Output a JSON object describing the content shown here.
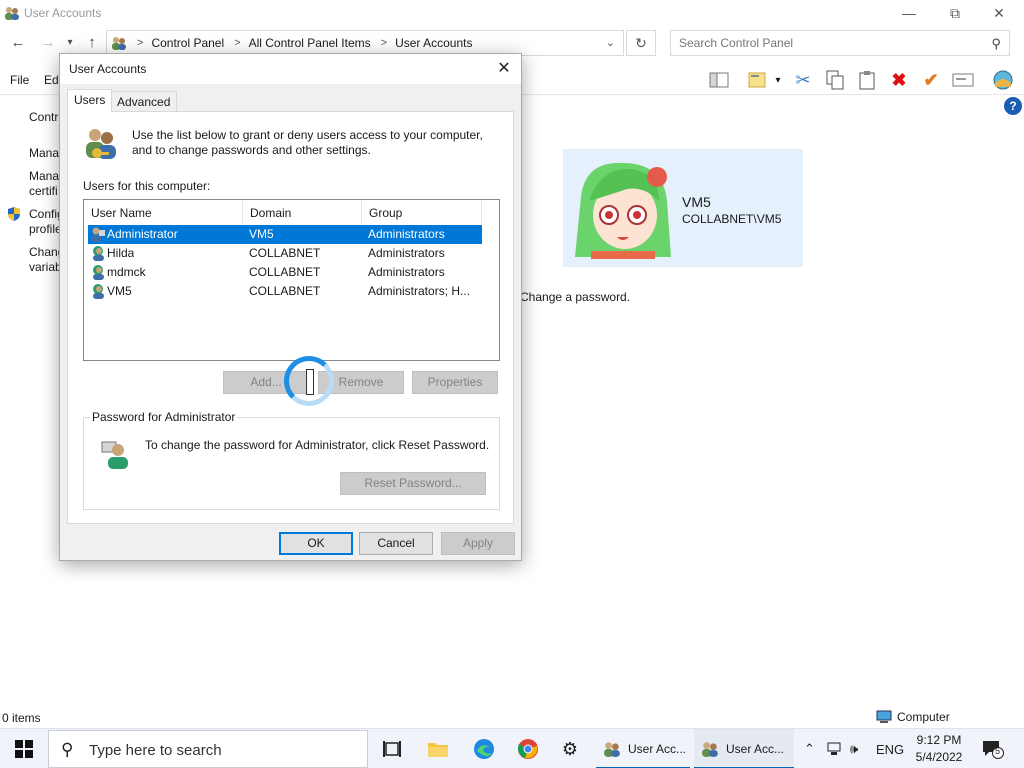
{
  "explorer": {
    "title": "User Accounts",
    "breadcrumbs": [
      "Control Panel",
      "All Control Panel Items",
      "User Accounts"
    ],
    "search_placeholder": "Search Control Panel",
    "menu": [
      "File",
      "Edi"
    ],
    "left_links": [
      "Contr",
      "Mana",
      "Mana",
      "certifi",
      "Config",
      "profile",
      "Chang",
      "variab"
    ],
    "user_card": {
      "name": "VM5",
      "account": "COLLABNET\\VM5"
    },
    "change_password_link": "Change a password.",
    "status_items": "0 items",
    "status_location": "Computer"
  },
  "dialog": {
    "title": "User Accounts",
    "tabs": [
      "Users",
      "Advanced"
    ],
    "intro": "Use the list below to grant or deny users access to your computer, and to change passwords and other settings.",
    "list_label": "Users for this computer:",
    "columns": [
      "User Name",
      "Domain",
      "Group"
    ],
    "users": [
      {
        "name": "Administrator",
        "domain": "VM5",
        "group": "Administrators",
        "selected": true
      },
      {
        "name": "Hilda",
        "domain": "COLLABNET",
        "group": "Administrators",
        "selected": false
      },
      {
        "name": "mdmck",
        "domain": "COLLABNET",
        "group": "Administrators",
        "selected": false
      },
      {
        "name": "VM5",
        "domain": "COLLABNET",
        "group": "Administrators; H...",
        "selected": false
      }
    ],
    "buttons": {
      "add": "Add...",
      "remove": "Remove",
      "properties": "Properties"
    },
    "password_group": {
      "legend": "Password for Administrator",
      "text": "To change the password for Administrator, click Reset Password.",
      "reset_button": "Reset Password..."
    },
    "footer": {
      "ok": "OK",
      "cancel": "Cancel",
      "apply": "Apply"
    }
  },
  "taskbar": {
    "search_placeholder": "Type here to search",
    "tasks": [
      "User Acc...",
      "User Acc..."
    ],
    "language": "ENG",
    "time": "9:12 PM",
    "date": "5/4/2022",
    "notification_count": "5"
  },
  "colors": {
    "accent": "#0078d7",
    "selection": "#0078d7",
    "card_bg": "#e4f0fb"
  }
}
